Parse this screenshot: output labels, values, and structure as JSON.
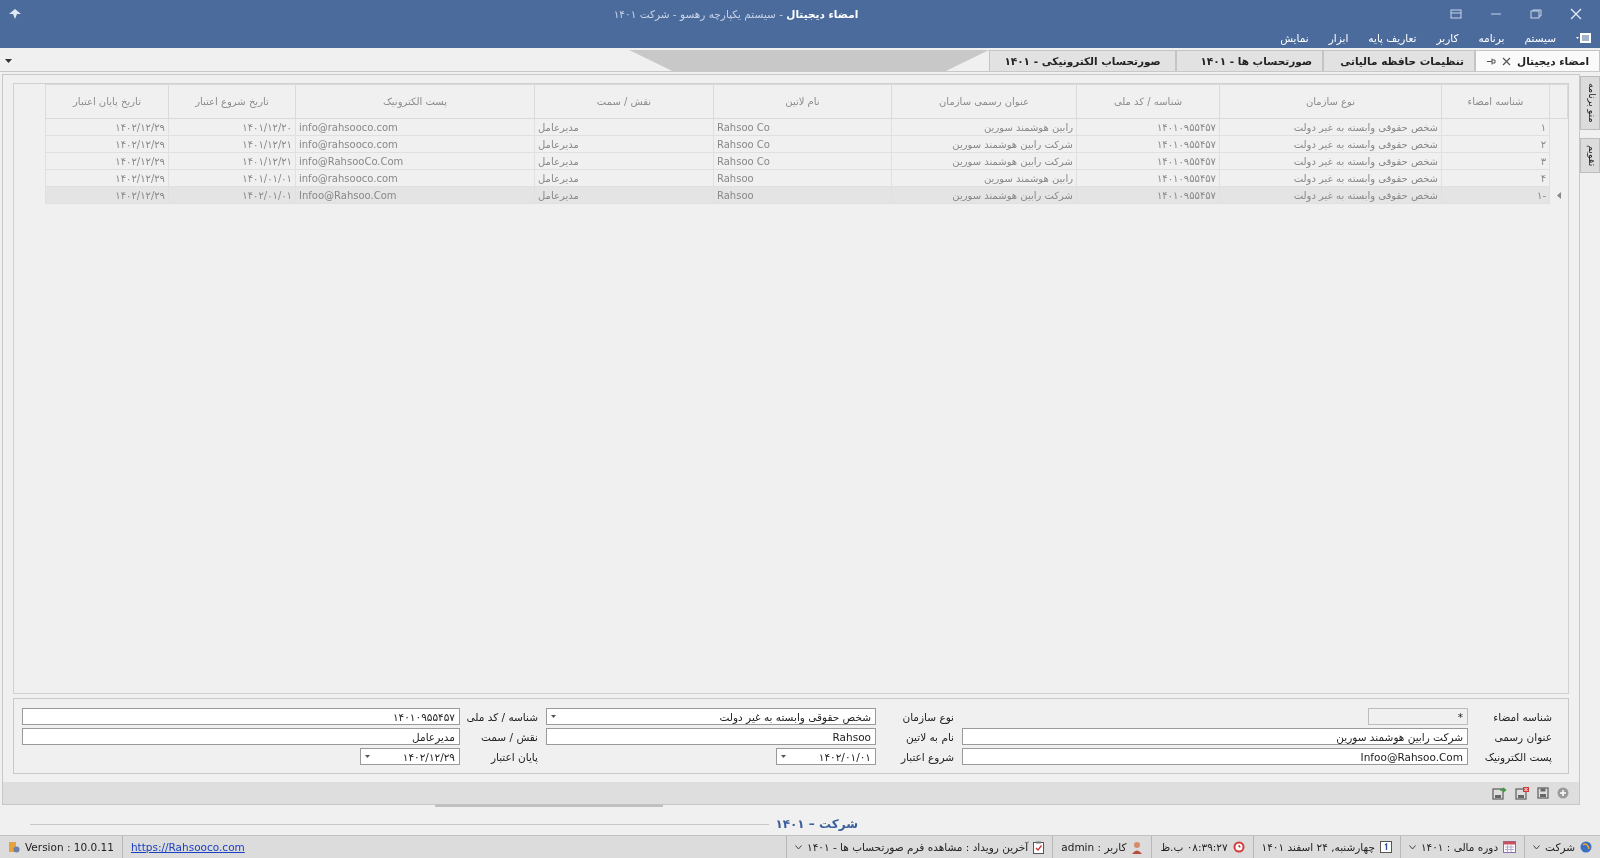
{
  "window": {
    "title": "**امضاء دیجیتال** - سیستم یکپارچه رهسو  - شرکت  ۱۴۰۱"
  },
  "menu": [
    "سیستم",
    "برنامه",
    "کاربر",
    "تعاریف پایه",
    "ابزار",
    "نمایش"
  ],
  "tabs": [
    {
      "label": "امضاء دیجیتال",
      "selected": true
    },
    {
      "label": "تنظیمات حافظه مالیاتی",
      "selected": false
    },
    {
      "label": "صورتحساب ها - ۱۴۰۱",
      "selected": false
    },
    {
      "label": "صورتحساب الکترونیکی - ۱۴۰۱",
      "selected": false
    }
  ],
  "side_tabs": [
    "منو برنامه",
    "تقویم"
  ],
  "grid": {
    "columns": [
      "شناسه امضاء",
      "نوع سازمان",
      "شناسه / کد ملی",
      "عنوان رسمی سازمان",
      "نام لاتین",
      "نقش / سمت",
      "پست الکترونیک",
      "تاریخ شروع اعتبار",
      "تاریخ پایان اعتبار"
    ],
    "rows": [
      {
        "selected": false,
        "cells": [
          "۱",
          "شخص حقوقی وابسته به غیر دولت",
          "۱۴۰۱۰۹۵۵۴۵۷",
          "رابین هوشمند سورین",
          "Rahsoo Co",
          "مدیرعامل",
          "info@rahsooco.com",
          "۱۴۰۱/۱۲/۲۰",
          "۱۴۰۲/۱۲/۲۹"
        ]
      },
      {
        "selected": false,
        "cells": [
          "۲",
          "شخص حقوقی وابسته به غیر دولت",
          "۱۴۰۱۰۹۵۵۴۵۷",
          "شرکت رابین هوشمند سورین",
          "Rahsoo Co",
          "مدیرعامل",
          "info@rahsooco.com",
          "۱۴۰۱/۱۲/۲۱",
          "۱۴۰۲/۱۲/۲۹"
        ]
      },
      {
        "selected": false,
        "cells": [
          "۳",
          "شخص حقوقی وابسته به غیر دولت",
          "۱۴۰۱۰۹۵۵۴۵۷",
          "شرکت رابین هوشمند سورین",
          "Rahsoo Co",
          "مدیرعامل",
          "info@RahsooCo.Com",
          "۱۴۰۱/۱۲/۲۱",
          "۱۴۰۲/۱۲/۲۹"
        ]
      },
      {
        "selected": false,
        "cells": [
          "۴",
          "شخص حقوقی وابسته به غیر دولت",
          "۱۴۰۱۰۹۵۵۴۵۷",
          "رابین هوشمند سورین",
          "Rahsoo",
          "مدیرعامل",
          "info@rahsooco.com",
          "۱۴۰۱/۰۱/۰۱",
          "۱۴۰۲/۱۲/۲۹"
        ]
      },
      {
        "selected": true,
        "cells": [
          "-۱",
          "شخص حقوقی وابسته به غیر دولت",
          "۱۴۰۱۰۹۵۵۴۵۷",
          "شرکت رابین هوشمند سورین",
          "Rahsoo",
          "مدیرعامل",
          "Infoo@Rahsoo.Com",
          "۱۴۰۲/۰۱/۰۱",
          "۱۴۰۲/۱۲/۲۹"
        ]
      }
    ]
  },
  "form": {
    "fields": [
      {
        "label": "شناسه امضاء",
        "value": "*",
        "kind": "readonly"
      },
      {
        "label": "نوع سازمان",
        "value": "شخص حقوقی وابسته به غیر دولت",
        "kind": "dropdown"
      },
      {
        "label": "شناسه / کد ملی",
        "value": "۱۴۰۱۰۹۵۵۴۵۷",
        "kind": "text"
      },
      {
        "label": "عنوان رسمی",
        "value": "شرکت رابین هوشمند سورین",
        "kind": "text"
      },
      {
        "label": "نام به لاتین",
        "value": "Rahsoo",
        "kind": "text"
      },
      {
        "label": "نقش / سمت",
        "value": "مدیرعامل",
        "kind": "text"
      },
      {
        "label": "پست الکترونیک",
        "value": "Infoo@Rahsoo.Com",
        "kind": "text"
      },
      {
        "label": "شروع اعتبار",
        "value": "۱۴۰۲/۰۱/۰۱",
        "kind": "date"
      },
      {
        "label": "پایان اعتبار",
        "value": "۱۴۰۲/۱۲/۲۹",
        "kind": "date"
      }
    ]
  },
  "footer": {
    "title": "شرکت – ۱۴۰۱"
  },
  "status_bar": {
    "items": [
      {
        "kind": "company",
        "text": "شرکت",
        "dropdown": true
      },
      {
        "kind": "period",
        "text": "دوره مالی : ۱۴۰۱",
        "dropdown": true
      },
      {
        "kind": "date",
        "text": "چهارشنبه, ۲۴ اسفند ۱۴۰۱",
        "dropdown": false
      },
      {
        "kind": "time",
        "text": "۰۸:۳۹:۲۷ ب.ظ",
        "dropdown": false
      },
      {
        "kind": "user",
        "text": "کاربر : admin",
        "dropdown": false
      },
      {
        "kind": "event",
        "text": "آخرین رویداد :  مشاهده فرم صورتحساب ها - ۱۴۰۱",
        "dropdown": true
      }
    ],
    "version": "Version : 10.0.11",
    "link": "https://Rahsooco.com"
  }
}
